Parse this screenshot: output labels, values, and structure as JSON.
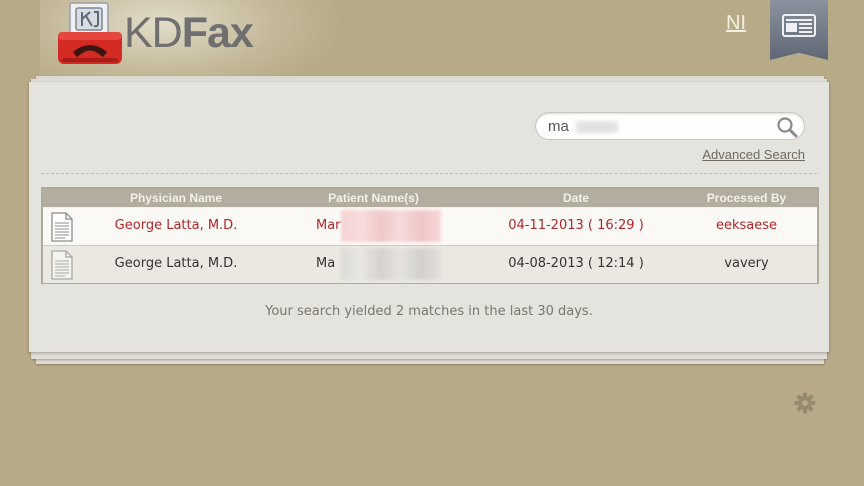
{
  "header": {
    "brand_part1": "KD",
    "brand_part2": "Fax",
    "user_initials": "NI"
  },
  "search": {
    "value": "ma",
    "advanced_label": "Advanced Search"
  },
  "table": {
    "columns": [
      "Physician Name",
      "Patient Name(s)",
      "Date",
      "Processed By"
    ],
    "rows": [
      {
        "physician": "George Latta, M.D.",
        "patient": "Mar",
        "date": "04-11-2013 ( 16:29 )",
        "processed_by": "eeksaese"
      },
      {
        "physician": "George Latta, M.D.",
        "patient": "Ma",
        "date": "04-08-2013 ( 12:14 )",
        "processed_by": "vavery"
      }
    ]
  },
  "summary": "Your search yielded 2 matches in the last 30 days.",
  "colors": {
    "background": "#b7aa87",
    "panel": "#e5e3de",
    "accent_red": "#b0262a",
    "header_row": "#b3ad9f"
  },
  "icons": [
    "fax-logo-icon",
    "news-icon",
    "search-icon",
    "document-icon",
    "gear-icon"
  ]
}
